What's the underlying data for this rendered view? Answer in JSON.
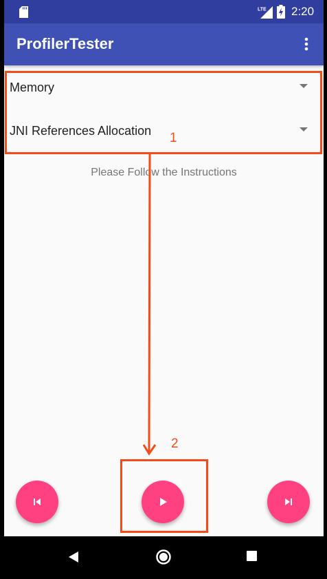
{
  "status_bar": {
    "time": "2:20",
    "network": "LTE",
    "icons": [
      "sd-card-icon",
      "lte-signal-icon",
      "battery-charging-icon"
    ]
  },
  "app_bar": {
    "title": "ProfilerTester",
    "icons": [
      "overflow-menu-icon"
    ]
  },
  "spinners": [
    {
      "value": "Memory"
    },
    {
      "value": "JNI References Allocation"
    }
  ],
  "instructions_text": "Please Follow the Instructions",
  "controls": {
    "icons": [
      "skip-previous-icon",
      "play-icon",
      "skip-next-icon"
    ],
    "accent_color": "#ff4081"
  },
  "nav_bar": {
    "icons": [
      "back-icon",
      "home-icon",
      "recents-icon"
    ]
  },
  "annotations": {
    "labels": [
      "1",
      "2"
    ],
    "color": "#f44b1a"
  },
  "colors": {
    "primary": "#3f51b5",
    "primary_dark": "#303f9f",
    "accent": "#ff4081"
  }
}
